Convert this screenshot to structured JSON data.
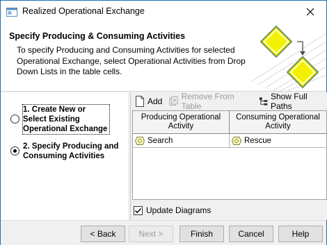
{
  "window": {
    "title": "Realized Operational Exchange"
  },
  "header": {
    "title": "Specify Producing & Consuming Activities",
    "description": "To specify Producing and Consuming Activities for selected Operational Exchange, select Operational Activities from Drop Down Lists in the table cells."
  },
  "steps": [
    {
      "label": "1. Create New or Select Existing Operational Exchange",
      "selected": false
    },
    {
      "label": "2. Specify Producing and Consuming Activities",
      "selected": true
    }
  ],
  "toolbar": {
    "add_label": "Add",
    "remove_label": "Remove From Table",
    "show_paths_label": "Show Full Paths"
  },
  "table": {
    "columns": [
      "Producing Operational Activity",
      "Consuming Operational Activity"
    ],
    "rows": [
      {
        "producing": "Search",
        "consuming": "Rescue"
      }
    ]
  },
  "update_diagrams": {
    "label": "Update Diagrams",
    "checked": true
  },
  "footer": {
    "back_label": "< Back",
    "next_label": "Next >",
    "finish_label": "Finish",
    "cancel_label": "Cancel",
    "help_label": "Help"
  },
  "colors": {
    "accent": "#1f6fb4",
    "diamond": "#f2f200"
  }
}
